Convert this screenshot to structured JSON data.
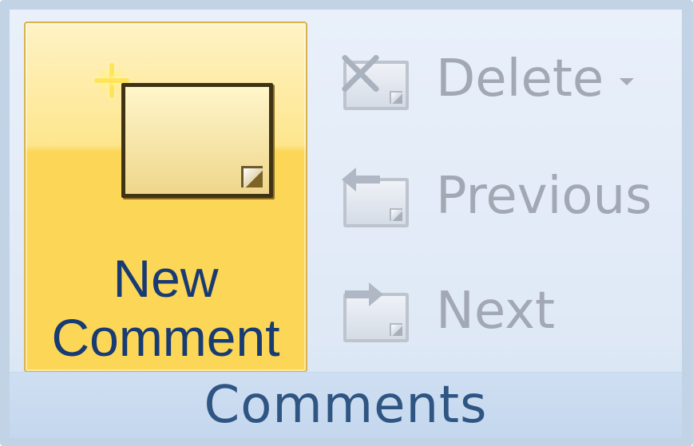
{
  "ribbon": {
    "group_label": "Comments",
    "buttons": {
      "new_comment": "New\nComment",
      "delete": "Delete",
      "previous": "Previous",
      "next": "Next"
    },
    "icons": {
      "new_comment": "new-comment-icon",
      "delete": "delete-comment-icon",
      "previous": "previous-comment-icon",
      "next": "next-comment-icon",
      "delete_menu": "chevron-down-icon"
    },
    "colors": {
      "active_button": "#fbd657",
      "label_text": "#183b73",
      "disabled_text": "#a2a9b4",
      "group_background": "#dfe9f6"
    }
  }
}
